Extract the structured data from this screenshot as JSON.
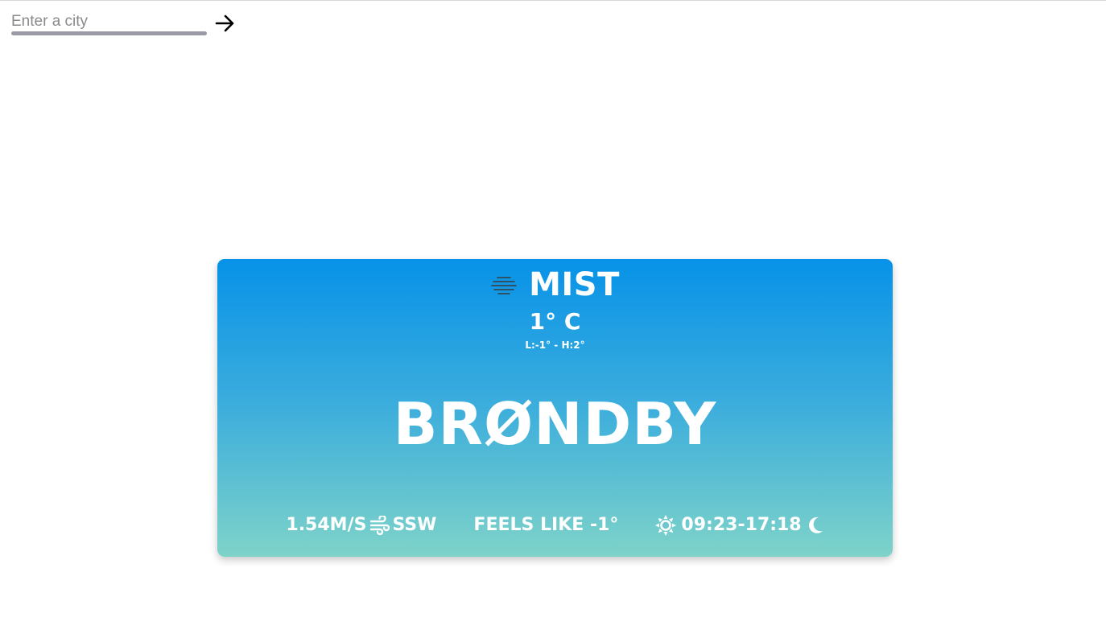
{
  "search": {
    "placeholder": "Enter a city",
    "value": ""
  },
  "weather": {
    "condition": "MIST",
    "condition_icon": "mist-icon",
    "temperature": "1° C",
    "low_high": "L:-1° - H:2°",
    "city": "BRØNDBY",
    "wind_speed": "1.54M/S",
    "wind_icon": "wind-icon",
    "wind_direction": "SSW",
    "feels_like": "FEELS LIKE -1°",
    "sun_icon": "sun-icon",
    "sun_times": "09:23-17:18",
    "moon_icon": "moon-icon"
  },
  "colors": {
    "card_gradient_top": "#0792e8",
    "card_gradient_bottom": "#7ed3c9",
    "text": "#ffffff"
  }
}
